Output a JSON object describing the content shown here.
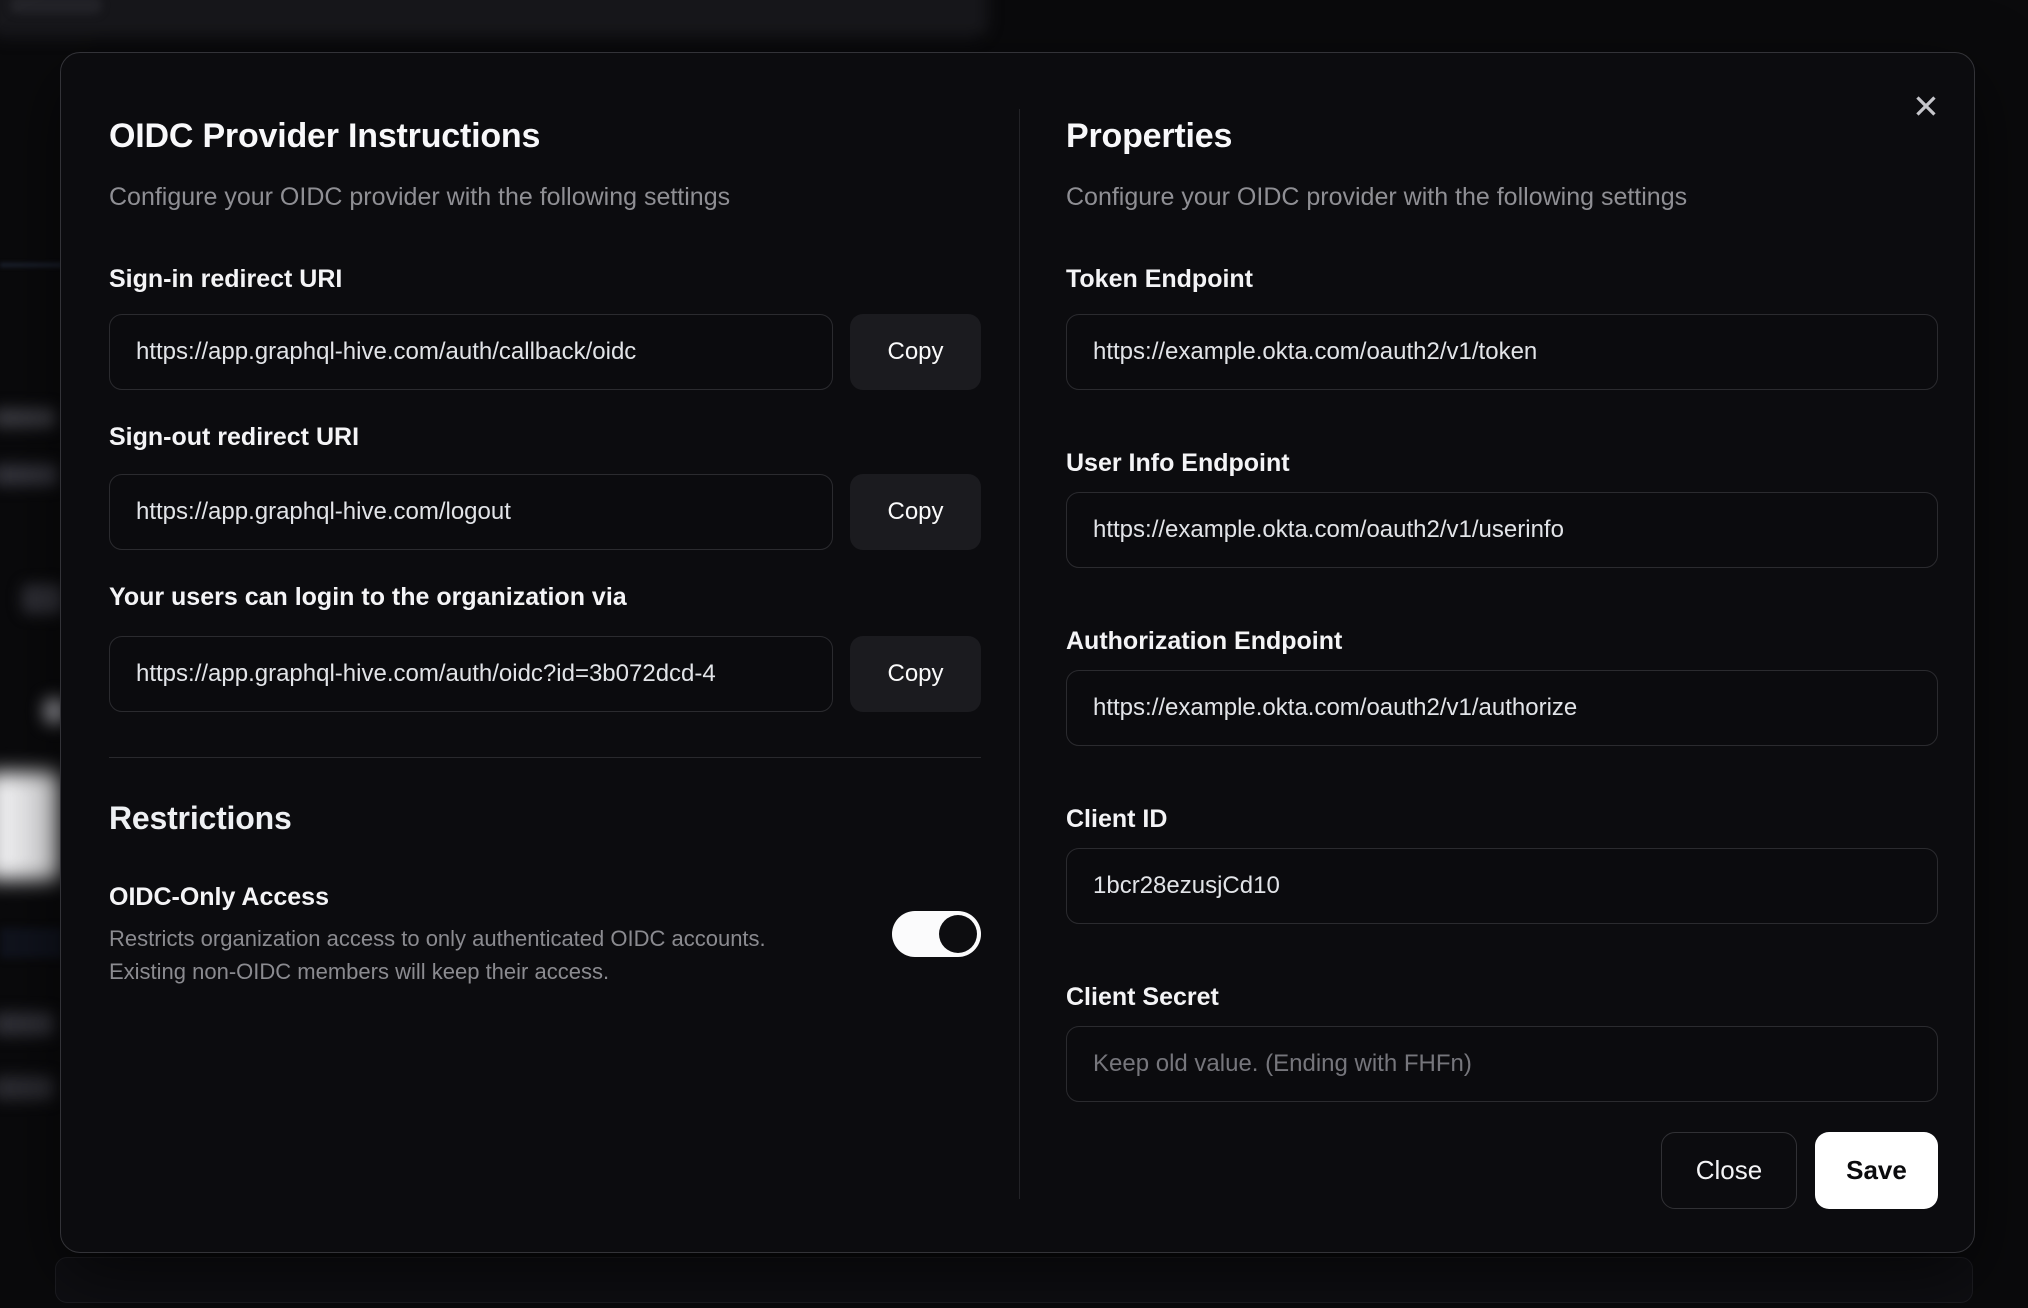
{
  "colors": {
    "modal_bg": "#0c0c0f",
    "save_button_bg": "#ffffff",
    "toggle_on": "#ffffff",
    "muted_text": "#8e8e93"
  },
  "modal": {
    "close_icon": "✕",
    "instructions": {
      "title": "OIDC Provider Instructions",
      "subtitle": "Configure your OIDC provider with the following settings",
      "fields": [
        {
          "label": "Sign-in redirect URI",
          "value": "https://app.graphql-hive.com/auth/callback/oidc",
          "button": "Copy"
        },
        {
          "label": "Sign-out redirect URI",
          "value": "https://app.graphql-hive.com/logout",
          "button": "Copy"
        },
        {
          "label": "Your users can login to the organization via",
          "value": "https://app.graphql-hive.com/auth/oidc?id=3b072dcd-4",
          "button": "Copy"
        }
      ],
      "restrictions": {
        "title": "Restrictions",
        "toggle_label": "OIDC-Only Access",
        "description_line1": "Restricts organization access to only authenticated OIDC accounts.",
        "description_line2": "Existing non-OIDC members will keep their access.",
        "state": "on"
      }
    },
    "properties": {
      "title": "Properties",
      "subtitle": "Configure your OIDC provider with the following settings",
      "fields": [
        {
          "label": "Token Endpoint",
          "value": "https://example.okta.com/oauth2/v1/token"
        },
        {
          "label": "User Info Endpoint",
          "value": "https://example.okta.com/oauth2/v1/userinfo"
        },
        {
          "label": "Authorization Endpoint",
          "value": "https://example.okta.com/oauth2/v1/authorize"
        },
        {
          "label": "Client ID",
          "value": "1bcr28ezusjCd10"
        },
        {
          "label": "Client Secret",
          "value": "",
          "placeholder": "Keep old value. (Ending with FHFn)"
        }
      ],
      "actions": {
        "close": "Close",
        "save": "Save"
      }
    }
  }
}
